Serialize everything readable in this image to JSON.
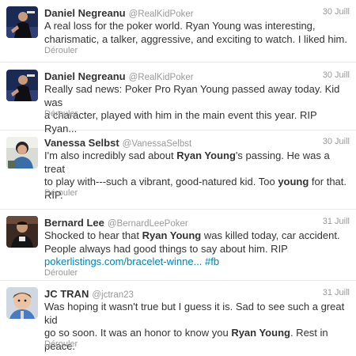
{
  "tweets": [
    {
      "name": "Daniel Negreanu",
      "handle": "@RealKidPoker",
      "time": "30 Juill",
      "text": [
        "A real loss for the poker world. Ryan Young was interesting,",
        "charismatic, a talker, aggressive, and exciting to watch. I liked him."
      ],
      "expand": "Dérouler",
      "avatar": "avatar-daniel-negreanu"
    },
    {
      "name": "Daniel Negreanu",
      "handle": "@RealKidPoker",
      "time": "30 Juill",
      "text": [
        "Really sad news: Poker Pro Ryan Young passed away today. Kid was",
        "a character, played with him in the main event this year. RIP Ryan..."
      ],
      "expand": "Dérouler",
      "avatar": "avatar-daniel-negreanu"
    },
    {
      "name": "Vanessa Selbst",
      "handle": "@VanessaSelbst",
      "time": "30 Juill",
      "text": [
        [
          "I'm also incredibly sad about ",
          {
            "b": "Ryan Young"
          },
          "'s passing. He was a treat"
        ],
        [
          "to play with---such a vibrant, good-natured kid. Too ",
          {
            "b": "young"
          },
          " for that."
        ],
        [
          "RIP."
        ]
      ],
      "expand": "Dérouler",
      "avatar": "avatar-vanessa-selbst"
    },
    {
      "name": "Bernard Lee",
      "handle": "@BernardLeePoker",
      "time": "31 Juill",
      "text": [
        [
          "Shocked to hear that ",
          {
            "b": "Ryan Young"
          },
          " was killed today, car accident."
        ],
        [
          "People always had good things to say about him. RIP"
        ],
        [
          {
            "a": "pokerlistings.com/bracelet-winne..."
          },
          " ",
          {
            "a": "#fb"
          }
        ]
      ],
      "expand": "Dérouler",
      "avatar": "avatar-bernard-lee"
    },
    {
      "name": "JC TRAN",
      "handle": "@jctran23",
      "time": "31 Juill",
      "text": [
        [
          "Was hoping it wasn't true but I guess it is. Sad to see such a great kid"
        ],
        [
          "go so soon. It was an honor to know you ",
          {
            "b": "Ryan Young"
          },
          ". Rest in"
        ],
        [
          "peace."
        ]
      ],
      "expand": "Dérouler",
      "avatar": "avatar-jc-tran"
    }
  ],
  "colors": {
    "link": "#0084b4",
    "meta": "#999999",
    "text": "#333333",
    "divider": "#e8e8e8"
  }
}
